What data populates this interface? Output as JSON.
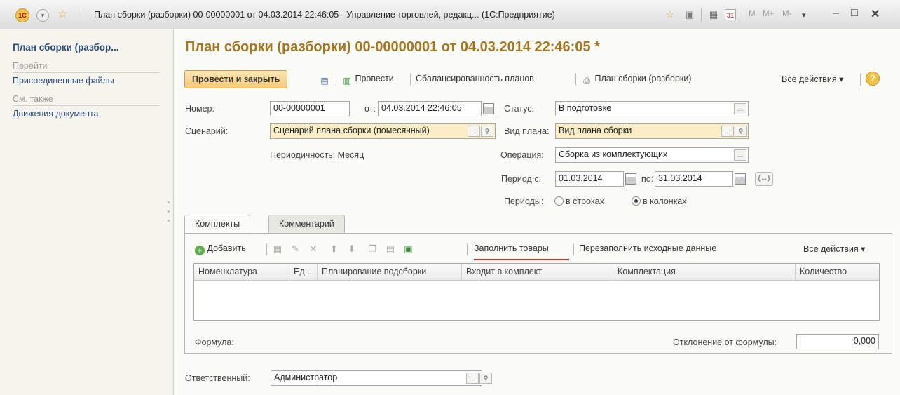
{
  "window": {
    "title": "План сборки (разборки) 00-00000001 от 04.03.2014 22:46:05 - Управление торговлей, редакц... (1С:Предприятие)",
    "logo": "1С",
    "m_buttons": [
      "M",
      "M+",
      "M-"
    ],
    "calendar_day": "31"
  },
  "sidebar": {
    "title": "План сборки (разбор...",
    "section_goto": "Перейти",
    "attached_files": "Присоединенные файлы",
    "section_see_also": "См. также",
    "document_movements": "Движения документа"
  },
  "document": {
    "title": "План сборки (разборки) 00-00000001 от 04.03.2014 22:46:05 *"
  },
  "toolbar": {
    "post_close": "Провести и закрыть",
    "post": "Провести",
    "balance": "Сбалансированность планов",
    "print": "План сборки (разборки)",
    "all_actions": "Все действия ▾"
  },
  "form": {
    "number_label": "Номер:",
    "number_value": "00-00000001",
    "date_label": "от:",
    "date_value": "04.03.2014 22:46:05",
    "status_label": "Статус:",
    "status_value": "В подготовке",
    "scenario_label": "Сценарий:",
    "scenario_value": "Сценарий плана сборки (помесячный)",
    "plan_type_label": "Вид плана:",
    "plan_type_value": "Вид плана сборки",
    "periodicity": "Периодичность: Месяц",
    "operation_label": "Операция:",
    "operation_value": "Сборка из комплектующих",
    "period_from_label": "Период с:",
    "period_from_value": "01.03.2014",
    "period_to_label": "по:",
    "period_to_value": "31.03.2014",
    "periods_label": "Периоды:",
    "periods_rows": "в строках",
    "periods_cols": "в колонках",
    "periods_selected": "в колонках"
  },
  "tabs": [
    {
      "label": "Комплекты",
      "active": true
    },
    {
      "label": "Комментарий",
      "active": false
    }
  ],
  "kits": {
    "add": "Добавить",
    "fill_goods": "Заполнить товары",
    "refill_source": "Перезаполнить исходные данные",
    "all_actions": "Все действия ▾",
    "columns": [
      "Номенклатура",
      "Ед...",
      "Планирование подсборки",
      "Входит в комплект",
      "Комплектация",
      "Количество"
    ],
    "rows": [],
    "formula_label": "Формула:",
    "deviation_label": "Отклонение от формулы:",
    "deviation_value": "0,000"
  },
  "responsible": {
    "label": "Ответственный:",
    "value": "Администратор"
  },
  "colors": {
    "title_accent": "#a8741c",
    "link": "#2c4a7a",
    "primary_button": "#f3c873",
    "highlight_field": "#fbeec6",
    "underline": "#d63030"
  }
}
